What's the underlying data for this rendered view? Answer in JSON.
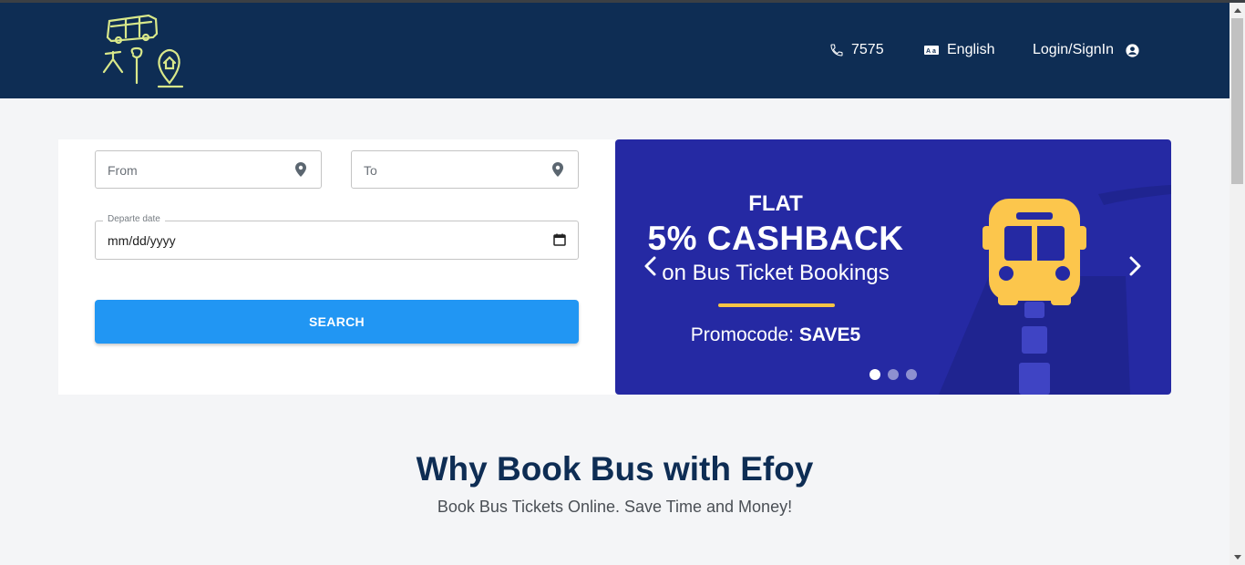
{
  "header": {
    "phone": "7575",
    "language": "English",
    "login": "Login/SignIn",
    "icons": [
      "phone-icon",
      "translate-icon",
      "user-circle-icon"
    ]
  },
  "search": {
    "from_placeholder": "From",
    "to_placeholder": "To",
    "date_label": "Departe date",
    "date_value": "mm/dd/yyyy",
    "button": "SEARCH"
  },
  "banner": {
    "line1": "FLAT",
    "line2": "5% CASHBACK",
    "line3": "on Bus Ticket Bookings",
    "promo_prefix": "Promocode:",
    "promo_code": "SAVE5",
    "slides": 3,
    "active_slide": 1
  },
  "section": {
    "title": "Why Book Bus with Efoy",
    "subtitle": "Book Bus Tickets Online. Save Time and Money!"
  },
  "colors": {
    "header_bg": "#0e2d54",
    "button": "#2196f3",
    "banner_bg": "#2529a3",
    "accent_yellow": "#f6c445"
  }
}
